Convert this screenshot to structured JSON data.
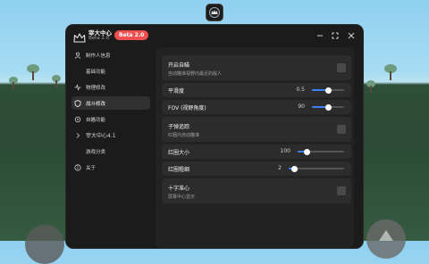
{
  "app": {
    "title": "宰大中心",
    "version": "Beta 2.0",
    "badge": "Beta 2.0"
  },
  "sidebar": {
    "items": [
      {
        "label": "制作人信息",
        "icon": "user-icon",
        "kind": "item",
        "active": false
      },
      {
        "label": "基础功能",
        "icon": "",
        "kind": "sub",
        "active": false
      },
      {
        "label": "物理修改",
        "icon": "activity-icon",
        "kind": "item",
        "active": false
      },
      {
        "label": "战斗修改",
        "icon": "shield-icon",
        "kind": "item",
        "active": true
      },
      {
        "label": "自瞄功能",
        "icon": "crosshair-icon",
        "kind": "item",
        "active": false
      },
      {
        "label": "宰大中心4.1",
        "icon": "chevron-right-icon",
        "kind": "group",
        "active": false
      },
      {
        "label": "游戏分类",
        "icon": "",
        "kind": "sub",
        "active": false
      },
      {
        "label": "关于",
        "icon": "info-icon",
        "kind": "item",
        "active": false
      }
    ]
  },
  "settings": {
    "silent_aim": {
      "title": "开启自瞄",
      "desc": "自动瞄准视野内最近的敌人",
      "checked": false
    },
    "smoothness": {
      "title": "平滑度",
      "value": "0.5",
      "fraction": 0.5
    },
    "fov": {
      "title": "FOV (视野角度)",
      "value": "90",
      "fraction": 0.5
    },
    "bullet_track": {
      "title": "子弹追踪",
      "desc": "红圈内自动瞄准",
      "checked": false
    },
    "circle_size": {
      "title": "红圈大小",
      "value": "100",
      "fraction": 0.2
    },
    "circle_thickness": {
      "title": "红圈粗细",
      "value": "2",
      "fraction": 0.1
    },
    "crosshair": {
      "title": "十字准心",
      "desc": "屏幕中心显示",
      "checked": false
    }
  },
  "colors": {
    "accent": "#3b82f6",
    "badge": "#ef4f4f",
    "window_bg": "#1b1b1b",
    "row_bg": "#2c2c2c"
  }
}
